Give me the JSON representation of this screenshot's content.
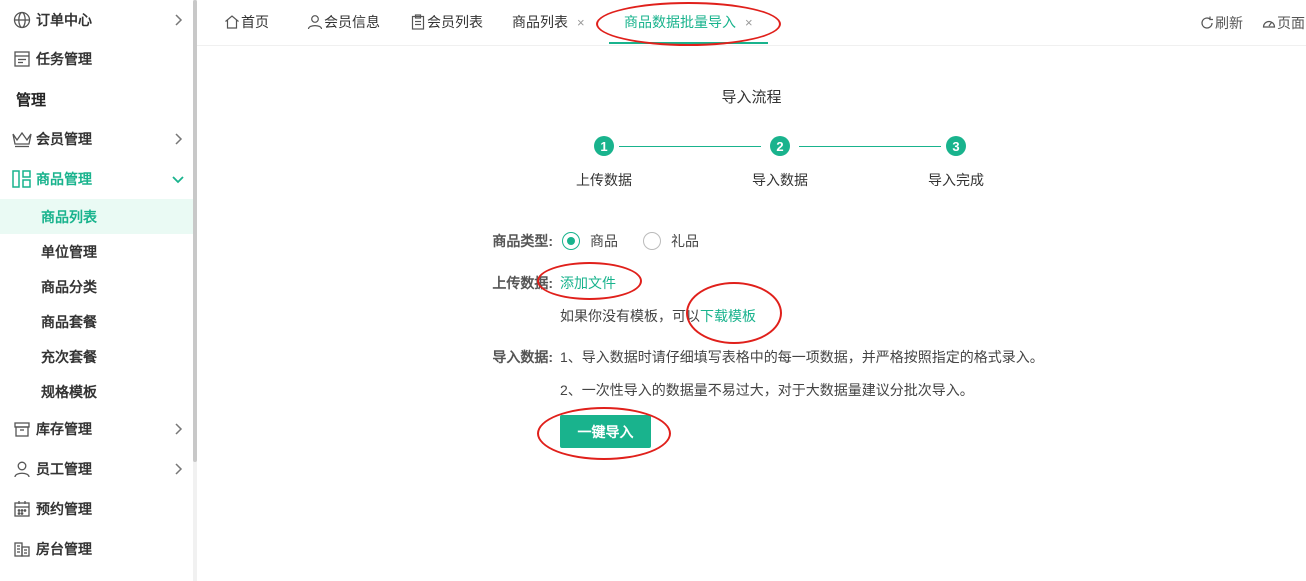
{
  "sidebar": {
    "items": [
      {
        "label": "订单中心",
        "icon": "globe-icon"
      },
      {
        "label": "任务管理",
        "icon": "task-list-icon"
      },
      {
        "label": "会员管理",
        "icon": "crown-icon"
      },
      {
        "label": "商品管理",
        "icon": "layout-grid-icon"
      },
      {
        "label": "库存管理",
        "icon": "archive-box-icon"
      },
      {
        "label": "员工管理",
        "icon": "user-icon"
      },
      {
        "label": "预约管理",
        "icon": "calendar-icon"
      },
      {
        "label": "房台管理",
        "icon": "building-icon"
      }
    ],
    "group_title": "管理",
    "sub_items": [
      {
        "label": "商品列表"
      },
      {
        "label": "单位管理"
      },
      {
        "label": "商品分类"
      },
      {
        "label": "商品套餐"
      },
      {
        "label": "充次套餐"
      },
      {
        "label": "规格模板"
      }
    ]
  },
  "tabs": [
    {
      "label": "首页",
      "icon": "home-icon"
    },
    {
      "label": "会员信息",
      "icon": "user-icon"
    },
    {
      "label": "会员列表",
      "icon": "clipboard-icon"
    },
    {
      "label": "商品列表",
      "close": "×"
    },
    {
      "label": "商品数据批量导入",
      "close": "×"
    }
  ],
  "toolbar": {
    "refresh": "刷新",
    "page": "页面"
  },
  "import": {
    "title": "导入流程",
    "steps": [
      {
        "num": "1",
        "label": "上传数据"
      },
      {
        "num": "2",
        "label": "导入数据"
      },
      {
        "num": "3",
        "label": "导入完成"
      }
    ],
    "type_label": "商品类型:",
    "type_options": [
      "商品",
      "礼品"
    ],
    "upload_label": "上传数据:",
    "add_file": "添加文件",
    "template_hint": "如果你没有模板，可以",
    "download_template": "下载模板",
    "import_label": "导入数据:",
    "notes": [
      "1、导入数据时请仔细填写表格中的每一项数据，并严格按照指定的格式录入。",
      "2、一次性导入的数据量不易过大，对于大数据量建议分批次导入。"
    ],
    "button": "一键导入"
  },
  "colors": {
    "accent": "#19b38d",
    "annotation": "#e0201b"
  }
}
